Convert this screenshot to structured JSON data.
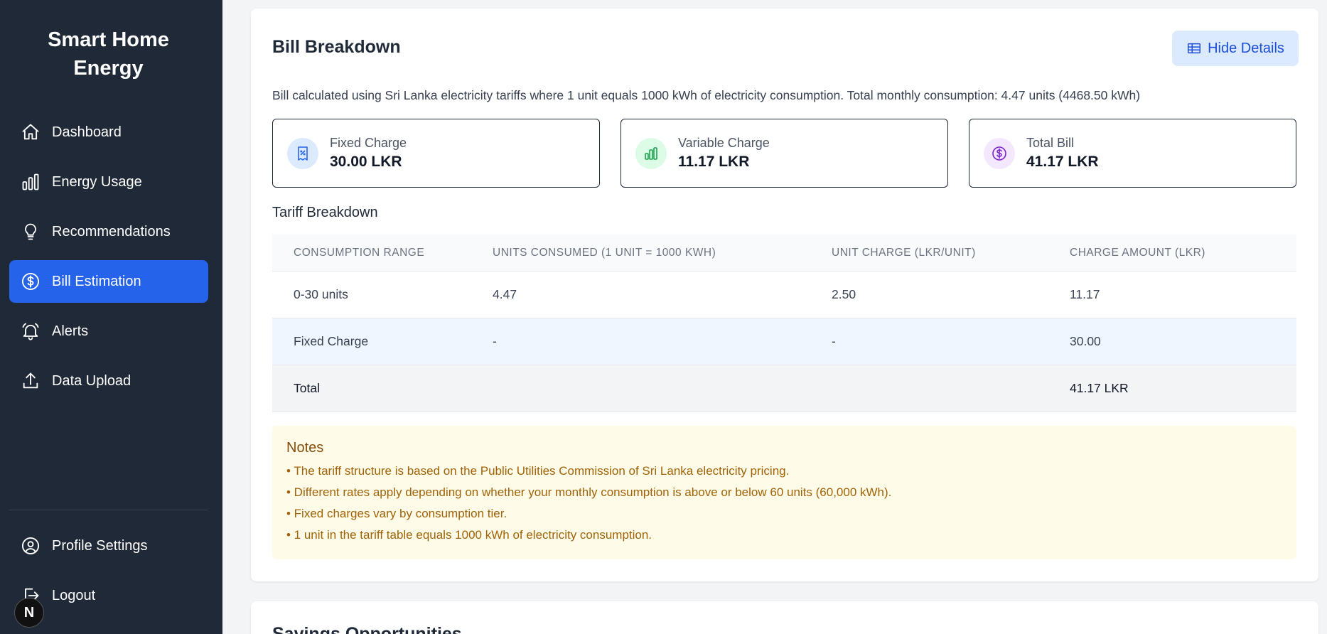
{
  "sidebar": {
    "brand_line1": "Smart Home",
    "brand_line2": "Energy",
    "items": [
      {
        "label": "Dashboard",
        "icon": "home-icon"
      },
      {
        "label": "Energy Usage",
        "icon": "bar-chart-icon"
      },
      {
        "label": "Recommendations",
        "icon": "lightbulb-icon"
      },
      {
        "label": "Bill Estimation",
        "icon": "dollar-circle-icon",
        "active": true
      },
      {
        "label": "Alerts",
        "icon": "bell-icon"
      },
      {
        "label": "Data Upload",
        "icon": "upload-icon"
      }
    ],
    "bottom_items": [
      {
        "label": "Profile Settings",
        "icon": "user-circle-icon"
      },
      {
        "label": "Logout",
        "icon": "logout-icon"
      }
    ],
    "badge": "N"
  },
  "bill": {
    "title": "Bill Breakdown",
    "hide_button": "Hide Details",
    "description": "Bill calculated using Sri Lanka electricity tariffs where 1 unit equals 1000 kWh of electricity consumption. Total monthly consumption: 4.47 units (4468.50 kWh)",
    "summary": [
      {
        "label": "Fixed Charge",
        "value": "30.00 LKR",
        "icon": "receipt-icon",
        "color": "#dbeafe"
      },
      {
        "label": "Variable Charge",
        "value": "11.17 LKR",
        "icon": "bar-chart-icon",
        "color": "#dcfce7"
      },
      {
        "label": "Total Bill",
        "value": "41.17 LKR",
        "icon": "dollar-circle-icon",
        "color": "#f3e8ff"
      }
    ],
    "tariff_title": "Tariff Breakdown",
    "table": {
      "headers": [
        "CONSUMPTION RANGE",
        "UNITS CONSUMED (1 UNIT = 1000 KWH)",
        "UNIT CHARGE (LKR/UNIT)",
        "CHARGE AMOUNT (LKR)"
      ],
      "rows": [
        [
          "0-30 units",
          "4.47",
          "2.50",
          "11.17"
        ],
        [
          "Fixed Charge",
          "-",
          "-",
          "30.00"
        ],
        [
          "Total",
          "",
          "",
          "41.17 LKR"
        ]
      ]
    },
    "notes": {
      "title": "Notes",
      "items": [
        "• The tariff structure is based on the Public Utilities Commission of Sri Lanka electricity pricing.",
        "• Different rates apply depending on whether your monthly consumption is above or below 60 units (60,000 kWh).",
        "• Fixed charges vary by consumption tier.",
        "• 1 unit in the tariff table equals 1000 kWh of electricity consumption."
      ]
    }
  },
  "savings": {
    "title": "Savings Opportunities"
  }
}
